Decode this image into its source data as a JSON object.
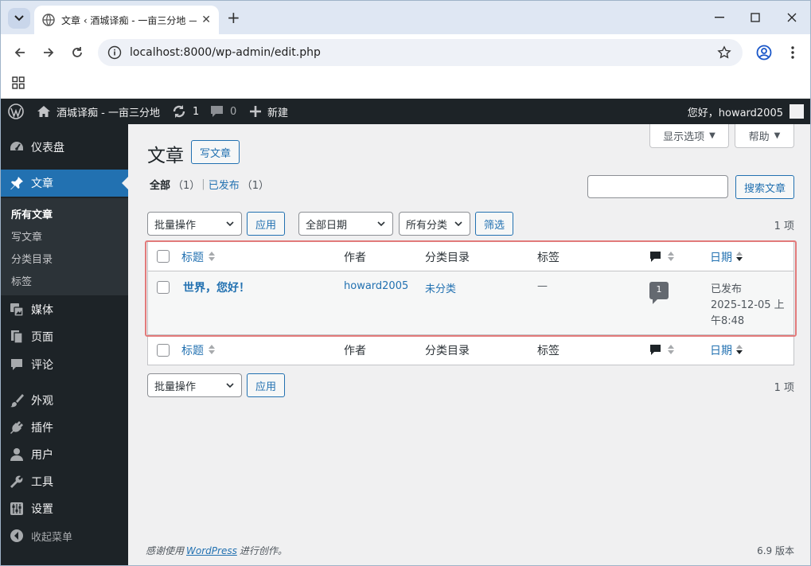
{
  "browser": {
    "tab_title": "文章 ‹ 酒城译痴 - 一亩三分地 — WordPress",
    "url": "localhost:8000/wp-admin/edit.php"
  },
  "adminbar": {
    "site_name": "酒城译痴 - 一亩三分地",
    "updates_count": "1",
    "comments_count": "0",
    "new_label": "新建",
    "greeting": "您好，howard2005"
  },
  "sidebar": {
    "dashboard": "仪表盘",
    "posts": "文章",
    "sub": [
      "所有文章",
      "写文章",
      "分类目录",
      "标签"
    ],
    "media": "媒体",
    "pages": "页面",
    "comments": "评论",
    "appearance": "外观",
    "plugins": "插件",
    "users": "用户",
    "tools": "工具",
    "settings": "设置",
    "collapse": "收起菜单"
  },
  "screen": {
    "screen_options": "显示选项",
    "help": "帮助"
  },
  "main": {
    "title": "文章",
    "add_new": "写文章",
    "filter_all": "全部",
    "filter_all_count": "（1）",
    "separator": "|",
    "filter_published": "已发布",
    "filter_published_count": "（1）",
    "search_placeholder": "",
    "search_button": "搜索文章",
    "bulk_actions": "批量操作",
    "apply": "应用",
    "all_dates": "全部日期",
    "all_categories": "所有分类",
    "filter_button": "筛选",
    "items_count": "1 项"
  },
  "table": {
    "headers": {
      "title": "标题",
      "author": "作者",
      "categories": "分类目录",
      "tags": "标签",
      "date": "日期"
    },
    "rows": [
      {
        "title": "世界，您好！",
        "author": "howard2005",
        "category": "未分类",
        "tags": "—",
        "comments": "1",
        "status": "已发布",
        "date_line1": "2025-12-05 上",
        "date_line2": "午8:48"
      }
    ]
  },
  "footer": {
    "thanks_prefix": "感谢使用",
    "wordpress": "WordPress",
    "thanks_suffix": "进行创作。",
    "version": "6.9 版本"
  },
  "colors": {
    "accent": "#2271b1",
    "adminbar_bg": "#1d2327",
    "highlight_outline": "#e27a7a"
  }
}
